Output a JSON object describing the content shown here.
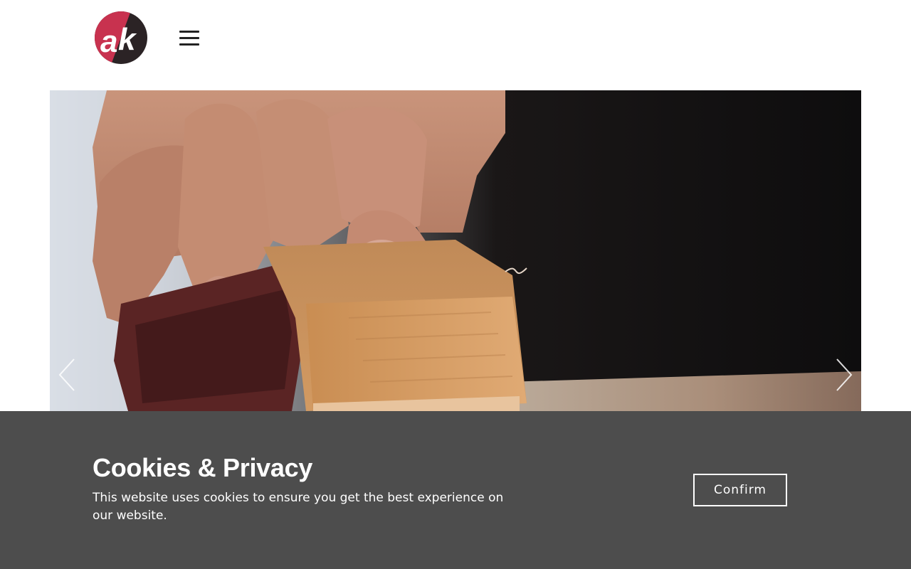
{
  "header": {
    "logo_text": "ak",
    "logo_icon": "ak-logo",
    "menu_icon": "hamburger-icon"
  },
  "slider": {
    "image": "hand-sanding-wood-block-photo",
    "prev_icon": "chevron-left-icon",
    "next_icon": "chevron-right-icon"
  },
  "cookie_banner": {
    "title": "Cookies & Privacy",
    "text": "This website uses cookies to ensure you get the best experience on our website.",
    "confirm_label": "Confirm"
  },
  "colors": {
    "brand_red": "#c8324f",
    "brand_dark": "#2b2325",
    "banner_bg": "#4d4d4d",
    "banner_text": "#ffffff"
  }
}
